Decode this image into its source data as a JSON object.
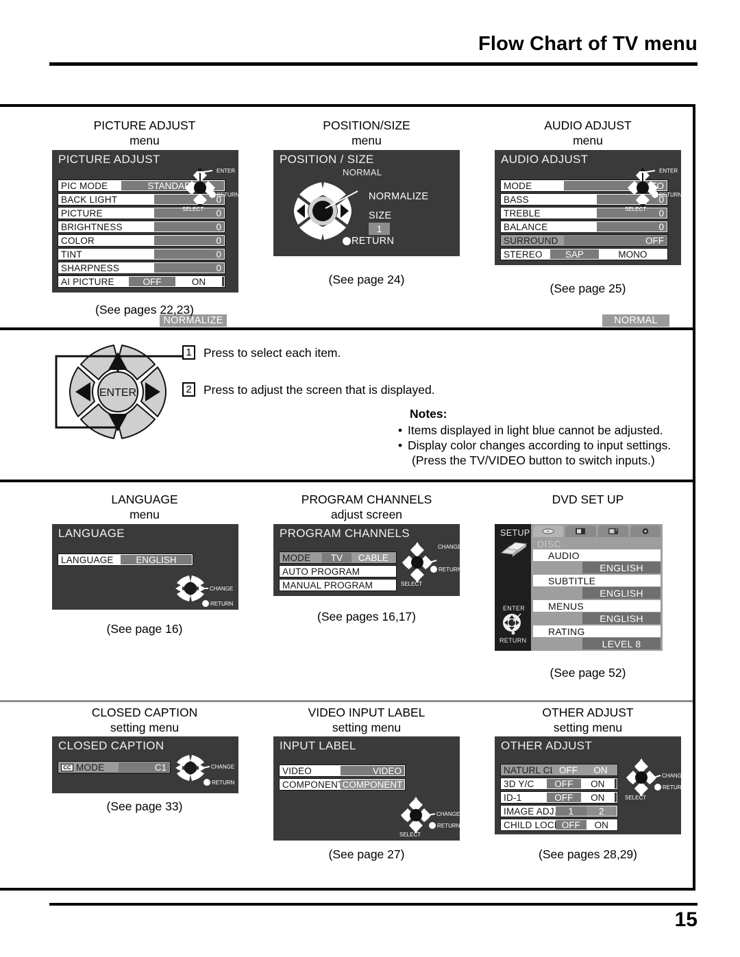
{
  "page": {
    "title": "Flow Chart of TV menu",
    "number": "15"
  },
  "sections": {
    "picture_adjust": {
      "caption_line1": "PICTURE ADJUST",
      "caption_line2": "menu",
      "see_page": "(See pages 22,23)",
      "osd": {
        "title": "PICTURE ADJUST",
        "normalize": "NORMALIZE",
        "rows": [
          {
            "label": "PIC  MODE",
            "value": "STANDARD"
          },
          {
            "label": "BACK  LIGHT",
            "value": "0"
          },
          {
            "label": "PICTURE",
            "value": "0"
          },
          {
            "label": "BRIGHTNESS",
            "value": "0"
          },
          {
            "label": "COLOR",
            "value": "0"
          },
          {
            "label": "TINT",
            "value": "0"
          },
          {
            "label": "SHARPNESS",
            "value": "0"
          }
        ],
        "ai_picture": {
          "label": "AI  PICTURE",
          "off": "OFF",
          "on": "ON"
        },
        "dpad": {
          "enter": "ENTER",
          "return": "RETURN",
          "select": "SELECT"
        }
      }
    },
    "position_size": {
      "caption_line1": "POSITION/SIZE",
      "caption_line2": "menu",
      "see_page": "(See page 24)",
      "osd": {
        "title": "POSITION / SIZE",
        "normal": "NORMAL",
        "normalize": "NORMALIZE",
        "size_label": "SIZE",
        "size_value": "1",
        "return": "RETURN"
      }
    },
    "audio_adjust": {
      "caption_line1": "AUDIO ADJUST",
      "caption_line2": "menu",
      "see_page": "(See page 25)",
      "osd": {
        "title": "AUDIO ADJUST",
        "normalize": "NORMAL",
        "rows": [
          {
            "label": "MODE",
            "value": "AUTO"
          },
          {
            "label": "BASS",
            "value": "0"
          },
          {
            "label": "TREBLE",
            "value": "0"
          },
          {
            "label": "BALANCE",
            "value": "0"
          },
          {
            "label": "SURROUND",
            "value": "OFF"
          }
        ],
        "stereo": {
          "label": "STEREO",
          "sap": "SAP",
          "mono": "MONO"
        },
        "dpad": {
          "enter": "ENTER",
          "return": "RETURN",
          "select": "SELECT"
        }
      }
    },
    "instructions": {
      "step1_num": "1",
      "step1_text": "Press to select each item.",
      "step2_num": "2",
      "step2_text": "Press to adjust the screen that is displayed.",
      "enter_label": "ENTER",
      "notes_heading": "Notes:",
      "notes": [
        "Items displayed in light blue cannot be adjusted.",
        "Display color changes according to input settings."
      ],
      "notes_sub": "(Press the TV/VIDEO button to switch inputs.)"
    },
    "language": {
      "caption_line1": "LANGUAGE",
      "caption_line2": "menu",
      "see_page": "(See page 16)",
      "osd": {
        "title": "LANGUAGE",
        "row": {
          "label": "LANGUAGE",
          "value": "ENGLISH"
        },
        "dpad": {
          "change": "CHANGE",
          "return": "RETURN"
        }
      }
    },
    "program_channels": {
      "caption_line1": "PROGRAM CHANNELS",
      "caption_line2": "adjust screen",
      "see_page": "(See pages 16,17)",
      "osd": {
        "title": "PROGRAM CHANNELS",
        "mode": {
          "label": "MODE",
          "tv": "TV",
          "cable": "CABLE"
        },
        "rows": [
          {
            "label": "AUTO     PROGRAM"
          },
          {
            "label": "MANUAL  PROGRAM"
          }
        ],
        "dpad": {
          "change": "CHANGE",
          "return": "RETURN",
          "select": "SELECT"
        }
      }
    },
    "dvd_setup": {
      "caption_line1": "DVD SET UP",
      "caption_line2": "",
      "see_page": "(See page 52)",
      "osd": {
        "setup_label": "SETUP",
        "enter": "ENTER",
        "return": "RETURN",
        "disc": "DISC",
        "tabs": [
          "disc-icon",
          "display-icon",
          "video-icon",
          "audio-icon"
        ],
        "rows": [
          {
            "label": "AUDIO",
            "value": "ENGLISH"
          },
          {
            "label": "SUBTITLE",
            "value": "ENGLISH"
          },
          {
            "label": "MENUS",
            "value": "ENGLISH"
          },
          {
            "label": "RATING",
            "value": "LEVEL 8"
          }
        ]
      }
    },
    "closed_caption": {
      "caption_line1": "CLOSED CAPTION",
      "caption_line2": "setting menu",
      "see_page": "(See page 33)",
      "osd": {
        "title": "CLOSED CAPTION",
        "badge": "CC",
        "row": {
          "label": "MODE",
          "value": "C1"
        },
        "dpad": {
          "change": "CHANGE",
          "return": "RETURN"
        }
      }
    },
    "video_input_label": {
      "caption_line1": "VIDEO INPUT LABEL",
      "caption_line2": "setting menu",
      "see_page": "(See page 27)",
      "osd": {
        "title": "INPUT LABEL",
        "rows": [
          {
            "label": "VIDEO",
            "value": "VIDEO"
          },
          {
            "label": "COMPONENT",
            "value": "COMPONENT"
          }
        ],
        "dpad": {
          "change": "CHANGE",
          "return": "RETURN",
          "select": "SELECT"
        }
      }
    },
    "other_adjust": {
      "caption_line1": "OTHER ADJUST",
      "caption_line2": "setting menu",
      "see_page": "(See pages 28,29)",
      "osd": {
        "title": "OTHER ADJUST",
        "rows": [
          {
            "label": "NATURL CLR",
            "off": "OFF",
            "on": "ON"
          },
          {
            "label": "3D Y/C",
            "off": "OFF",
            "on": "ON"
          },
          {
            "label": "ID-1",
            "off": "OFF",
            "on": "ON"
          },
          {
            "label": "IMAGE ADJ.",
            "off": "1",
            "on": "2"
          },
          {
            "label": "CHILD LOCK",
            "off": "OFF",
            "on": "ON"
          }
        ],
        "dpad": {
          "change": "CHANGE",
          "return": "RETURN",
          "select": "SELECT"
        }
      }
    }
  },
  "colors": {
    "osd_background": "#3a3a3a",
    "row_white": "#ffffff",
    "value_grey": "#7b7b7b",
    "normalize_grey": "#9a9a9a",
    "dvd_panel": "#9e9e9e",
    "dvd_sidebar": "#1e1e1e",
    "rule": "#000000"
  }
}
